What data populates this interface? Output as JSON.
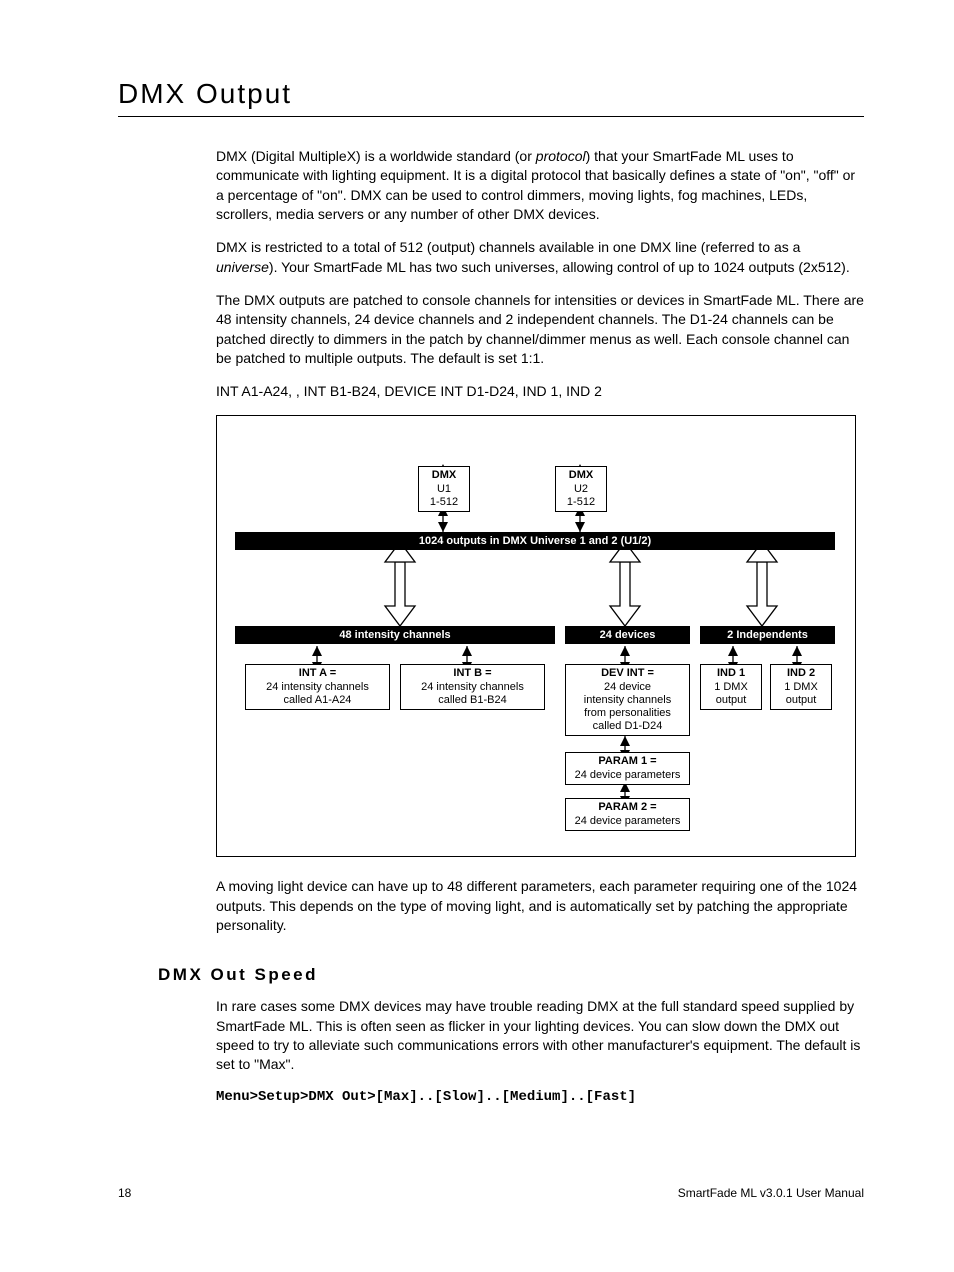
{
  "title": "DMX Output",
  "p1_a": "DMX (Digital MultipleX) is a worldwide standard (or ",
  "p1_i": "protocol",
  "p1_b": ") that your SmartFade ML uses to communicate with lighting equipment. It is a digital protocol that basically defines a state of \"on\", \"off\" or a percentage of \"on\". DMX can be used to control dimmers, moving lights, fog machines, LEDs, scrollers, media servers or any number of other DMX devices.",
  "p2_a": "DMX is restricted to a total of 512 (output) channels available in one DMX line (referred to as a ",
  "p2_i": "universe",
  "p2_b": "). Your SmartFade ML has two such universes, allowing control of up to 1024 outputs (2x512).",
  "p3": "The DMX outputs are patched to console channels for intensities or devices in SmartFade ML. There are 48 intensity channels, 24 device channels and 2 independent channels. The D1-24 channels can be patched directly to dimmers in the patch by channel/dimmer menus as well. Each console channel can be patched to multiple outputs. The default is set 1:1.",
  "p4": "INT A1-A24, , INT B1-B24, DEVICE INT D1-D24, IND 1, IND 2",
  "p5": "A moving light device can have up to 48 different parameters, each parameter requiring one of the 1024 outputs. This depends on the type of moving light, and is automatically set by patching the appropriate personality.",
  "h2": "DMX Out Speed",
  "p6": "In rare cases some DMX devices may have trouble reading DMX at the full standard speed supplied by SmartFade ML. This is often seen as flicker in your lighting devices. You can slow down the DMX out speed to try to alleviate such communications errors with other manufacturer's equipment. The default is set to \"Max\".",
  "menu_path": "Menu>Setup>DMX Out>[Max]..[Slow]..[Medium]..[Fast]",
  "footer_left": "18",
  "footer_right": "SmartFade ML v3.0.1 User Manual",
  "diagram": {
    "dmx_u1_l1": "DMX",
    "dmx_u1_l2": "U1",
    "dmx_u1_l3": "1-512",
    "dmx_u2_l1": "DMX",
    "dmx_u2_l2": "U2",
    "dmx_u2_l3": "1-512",
    "bar_top": "1024 outputs in DMX Universe 1 and 2 (U1/2)",
    "bar_48": "48 intensity channels",
    "bar_24d": "24 devices",
    "bar_2i": "2 Independents",
    "intA_t": "INT A =",
    "intA_l1": "24 intensity channels",
    "intA_l2": "called A1-A24",
    "intB_t": "INT B =",
    "intB_l1": "24 intensity channels",
    "intB_l2": "called B1-B24",
    "dev_t": "DEV INT =",
    "dev_l1": "24 device",
    "dev_l2": "intensity channels",
    "dev_l3": "from personalities",
    "dev_l4": "called D1-D24",
    "ind1_t": "IND 1",
    "ind1_l1": "1 DMX",
    "ind1_l2": "output",
    "ind2_t": "IND 2",
    "ind2_l1": "1 DMX",
    "ind2_l2": "output",
    "p1_t": "PARAM 1 =",
    "p1_l": "24 device parameters",
    "p2_t": "PARAM 2 =",
    "p2_l": "24 device parameters"
  }
}
